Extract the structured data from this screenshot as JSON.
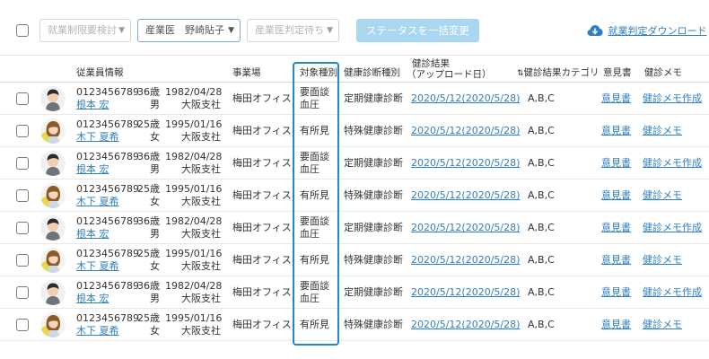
{
  "toolbar": {
    "filter_restriction": "就業制限要検討",
    "filter_doctor": "産業医　野崎貼子",
    "filter_status": "産業医判定待ち",
    "bulk_change_label": "ステータスを一括変更",
    "download_label": "就業判定ダウンロード"
  },
  "columns": {
    "employee": "従業員情報",
    "office": "事業場",
    "target_type": "対象種別",
    "exam_type": "健康診断種別",
    "result_line1": "健診結果",
    "result_line2": "（アップロード日）",
    "category": "健診結果カテゴリ",
    "opinion": "意見書",
    "memo": "健診メモ"
  },
  "rows": [
    {
      "id": "0123456789",
      "name": "根本 宏",
      "age": "36歳",
      "sex": "男",
      "dob": "1982/04/28",
      "branch": "大阪支社",
      "office": "梅田オフィス",
      "target1": "要面談",
      "target2": "血圧",
      "exam": "定期健康診断",
      "result": "2020/5/12(2020/5/28)",
      "category": "A,B,C",
      "opinion": "意見書",
      "memo": "健診メモ作成",
      "avatar": "male"
    },
    {
      "id": "0123456789",
      "name": "木下 夏希",
      "age": "25歳",
      "sex": "女",
      "dob": "1995/01/16",
      "branch": "大阪支社",
      "office": "梅田オフィス",
      "target1": "有所見",
      "target2": "",
      "exam": "特殊健康診断",
      "result": "2020/5/12(2020/5/28)",
      "category": "A,B,C",
      "opinion": "意見書",
      "memo": "健診メモ",
      "avatar": "female"
    },
    {
      "id": "0123456789",
      "name": "根本 宏",
      "age": "36歳",
      "sex": "男",
      "dob": "1982/04/28",
      "branch": "大阪支社",
      "office": "梅田オフィス",
      "target1": "要面談",
      "target2": "血圧",
      "exam": "定期健康診断",
      "result": "2020/5/12(2020/5/28)",
      "category": "A,B,C",
      "opinion": "意見書",
      "memo": "健診メモ作成",
      "avatar": "male"
    },
    {
      "id": "0123456789",
      "name": "木下 夏希",
      "age": "25歳",
      "sex": "女",
      "dob": "1995/01/16",
      "branch": "大阪支社",
      "office": "梅田オフィス",
      "target1": "有所見",
      "target2": "",
      "exam": "特殊健康診断",
      "result": "2020/5/12(2020/5/28)",
      "category": "A,B,C",
      "opinion": "意見書",
      "memo": "健診メモ",
      "avatar": "female"
    },
    {
      "id": "0123456789",
      "name": "根本 宏",
      "age": "36歳",
      "sex": "男",
      "dob": "1982/04/28",
      "branch": "大阪支社",
      "office": "梅田オフィス",
      "target1": "要面談",
      "target2": "血圧",
      "exam": "定期健康診断",
      "result": "2020/5/12(2020/5/28)",
      "category": "A,B,C",
      "opinion": "意見書",
      "memo": "健診メモ作成",
      "avatar": "male"
    },
    {
      "id": "0123456789",
      "name": "木下 夏希",
      "age": "25歳",
      "sex": "女",
      "dob": "1995/01/16",
      "branch": "大阪支社",
      "office": "梅田オフィス",
      "target1": "有所見",
      "target2": "",
      "exam": "特殊健康診断",
      "result": "2020/5/12(2020/5/28)",
      "category": "A,B,C",
      "opinion": "意見書",
      "memo": "健診メモ",
      "avatar": "female"
    },
    {
      "id": "0123456789",
      "name": "根本 宏",
      "age": "36歳",
      "sex": "男",
      "dob": "1982/04/28",
      "branch": "大阪支社",
      "office": "梅田オフィス",
      "target1": "要面談",
      "target2": "血圧",
      "exam": "定期健康診断",
      "result": "2020/5/12(2020/5/28)",
      "category": "A,B,C",
      "opinion": "意見書",
      "memo": "健診メモ作成",
      "avatar": "male"
    },
    {
      "id": "0123456789",
      "name": "木下 夏希",
      "age": "25歳",
      "sex": "女",
      "dob": "1995/01/16",
      "branch": "大阪支社",
      "office": "梅田オフィス",
      "target1": "有所見",
      "target2": "",
      "exam": "特殊健康診断",
      "result": "2020/5/12(2020/5/28)",
      "category": "A,B,C",
      "opinion": "意見書",
      "memo": "健診メモ",
      "avatar": "female"
    }
  ],
  "colors": {
    "accent": "#2f7fc1",
    "highlight": "#1f86cf",
    "bulk_button": "#a9d6f1"
  },
  "icons": {
    "download": "cloud-download-icon",
    "sort": "sort-icon",
    "caret": "chevron-down-icon"
  }
}
